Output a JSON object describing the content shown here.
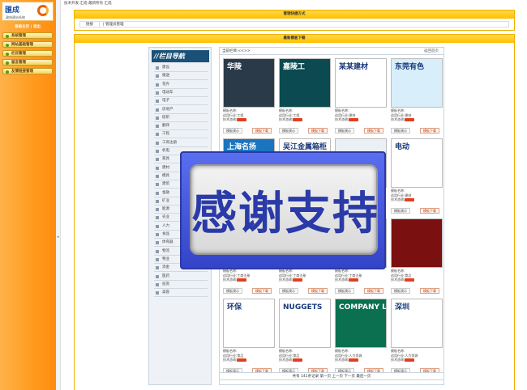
{
  "topbar": {
    "text": "技术开发:汇成-最新所有 汇成"
  },
  "logo": {
    "mark": "匯成",
    "subtitle": "政府建站系统"
  },
  "left": {
    "home_link": "系统主页 | 退出",
    "nav": [
      "系统管理",
      "网站基础管理",
      "栏目管理",
      "留言管理",
      "友情链接管理"
    ]
  },
  "quick": {
    "title": "管理快捷方式",
    "cell1": "链接",
    "cell2": "| 管理员管理"
  },
  "main": {
    "title": "最新模板下载"
  },
  "sidebar": {
    "header": "//栏目导航",
    "items": [
      "建设",
      "报送",
      "花卉",
      "电动车",
      "电子",
      "房地产",
      "纺织",
      "翻译",
      "工程",
      "工商注册",
      "机电",
      "家具",
      "建材",
      "模具",
      "建筑",
      "金融",
      "矿业",
      "能源",
      "农业",
      "人力",
      "食品",
      "体育器",
      "物流",
      "物业",
      "消金",
      "医药",
      "投资",
      "美容"
    ]
  },
  "content": {
    "crumb": "当前栏目:<<>>",
    "back": "返回首页"
  },
  "cards": [
    {
      "thumb": "华陵",
      "name": "模板名称:",
      "industry": "适用行业:工程",
      "support": "技术咨询:",
      "demo": "模板演示",
      "download": "模板下载",
      "color": "#2a3a48"
    },
    {
      "thumb": "嘉陵工",
      "name": "模板名称:",
      "industry": "适用行业:工程",
      "support": "技术咨询:",
      "demo": "模板演示",
      "download": "模板下载",
      "color": "#0a4a50"
    },
    {
      "thumb": "某某建材",
      "name": "模板名称:",
      "industry": "适用行业:建材",
      "support": "技术咨询:",
      "demo": "模板演示",
      "download": "模板下载",
      "color": "#ffffff"
    },
    {
      "thumb": "东莞有色",
      "name": "模板名称:",
      "industry": "适用行业:建材",
      "support": "技术咨询:",
      "demo": "模板演示",
      "download": "模板下载",
      "color": "#d8eefa"
    },
    {
      "thumb": "上海名扬",
      "name": "模板名称:",
      "industry": "适用行业:",
      "support": "技术咨询:",
      "demo": "模板演示",
      "download": "模板下载",
      "color": "#1a74c0"
    },
    {
      "thumb": "吴江金属箱柜",
      "name": "模板名称:",
      "industry": "适用行业:",
      "support": "技术咨询:",
      "demo": "模板演示",
      "download": "模板下载",
      "color": "#ffffff"
    },
    {
      "thumb": "",
      "name": "模板名称:",
      "industry": "适用行业:",
      "support": "技术咨询:",
      "demo": "模板演示",
      "download": "模板下载",
      "color": "#eaf0f6"
    },
    {
      "thumb": "电动",
      "name": "模板名称:",
      "industry": "适用行业:建材",
      "support": "技术咨询:",
      "demo": "模板演示",
      "download": "模板下载",
      "color": "#ffffff"
    },
    {
      "thumb": "",
      "name": "模板名称:",
      "industry": "适用行业:工商注册",
      "support": "技术咨询:",
      "demo": "模板演示",
      "download": "模板下载",
      "color": "#ffffff"
    },
    {
      "thumb": "",
      "name": "模板名称:",
      "industry": "适用行业:工商注册",
      "support": "技术咨询:",
      "demo": "模板演示",
      "download": "模板下载",
      "color": "#ffffff"
    },
    {
      "thumb": "",
      "name": "模板名称:",
      "industry": "适用行业:工商注册",
      "support": "技术咨询:",
      "demo": "模板演示",
      "download": "模板下载",
      "color": "#ffffff"
    },
    {
      "thumb": "",
      "name": "模板名称:",
      "industry": "适用行业:食品",
      "support": "技术咨询:",
      "demo": "模板演示",
      "download": "模板下载",
      "color": "#7a1010"
    },
    {
      "thumb": "环保",
      "name": "模板名称:",
      "industry": "适用行业:食品",
      "support": "技术咨询:",
      "demo": "模板演示",
      "download": "模板下载",
      "color": "#ffffff"
    },
    {
      "thumb": "NUGGETS",
      "name": "模板名称:",
      "industry": "适用行业:食品",
      "support": "技术咨询:",
      "demo": "模板演示",
      "download": "模板下载",
      "color": "#ffffff"
    },
    {
      "thumb": "COMPANY LOGO",
      "name": "模板名称:",
      "industry": "适用行业:人力资源",
      "support": "技术咨询:",
      "demo": "模板演示",
      "download": "模板下载",
      "color": "#0a7050"
    },
    {
      "thumb": "深圳",
      "name": "模板名称:",
      "industry": "适用行业:人力资源",
      "support": "技术咨询:",
      "demo": "模板演示",
      "download": "模板下载",
      "color": "#ffffff"
    }
  ],
  "pager": {
    "text": "共有 141条记录 第一页 上一页 下一页 最后一页"
  },
  "overlay": {
    "text": "感谢支持"
  }
}
